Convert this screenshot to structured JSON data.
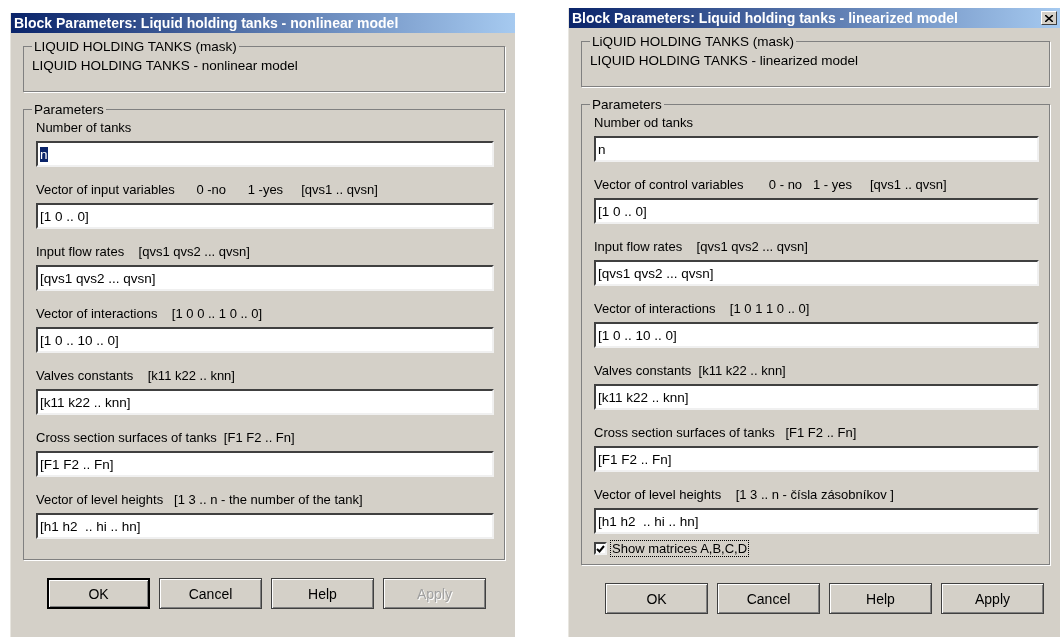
{
  "dialogs": [
    {
      "title": "Block Parameters: Liquid holding tanks - nonlinear model",
      "close_button": false,
      "mask": {
        "title": "LIQUID HOLDING TANKS (mask)",
        "description": "LIQUID HOLDING TANKS - nonlinear model"
      },
      "parameters": {
        "title": "Parameters",
        "fields": [
          {
            "label": "Number of tanks",
            "value": "n",
            "text_selected": true
          },
          {
            "label": "Vector of input variables      0 -no      1 -yes     [qvs1 .. qvsn]",
            "value": "[1 0 .. 0]",
            "text_selected": false
          },
          {
            "label": "Input flow rates    [qvs1 qvs2 ... qvsn]",
            "value": "[qvs1 qvs2 ... qvsn]",
            "text_selected": false
          },
          {
            "label": "Vector of interactions    [1 0 0 .. 1 0 .. 0]",
            "value": "[1 0 .. 10 .. 0]",
            "text_selected": false
          },
          {
            "label": "Valves constants    [k11 k22 .. knn]",
            "value": "[k11 k22 .. knn]",
            "text_selected": false
          },
          {
            "label": "Cross section surfaces of tanks  [F1 F2 .. Fn]",
            "value": "[F1 F2 .. Fn]",
            "text_selected": false
          },
          {
            "label": "Vector of level heights   [1 3 .. n - the number of the tank]",
            "value": "[h1 h2  .. hi .. hn]",
            "text_selected": false
          }
        ]
      },
      "buttons": [
        {
          "label": "OK",
          "default": true,
          "disabled": false
        },
        {
          "label": "Cancel",
          "default": false,
          "disabled": false
        },
        {
          "label": "Help",
          "default": false,
          "disabled": false
        },
        {
          "label": "Apply",
          "default": false,
          "disabled": true
        }
      ]
    },
    {
      "title": "Block Parameters: Liquid holding tanks - linearized model",
      "close_button": true,
      "mask": {
        "title": "LiQUID HOLDING TANKS (mask)",
        "description": "LIQUID HOLDING TANKS - linearized model"
      },
      "parameters": {
        "title": "Parameters",
        "fields": [
          {
            "label": "Number od tanks",
            "value": "n",
            "text_selected": false
          },
          {
            "label": "Vector of control variables       0 - no   1 - yes     [qvs1 .. qvsn]",
            "value": "[1 0 .. 0]",
            "text_selected": false
          },
          {
            "label": "Input flow rates    [qvs1 qvs2 ... qvsn]",
            "value": "[qvs1 qvs2 ... qvsn]",
            "text_selected": false
          },
          {
            "label": "Vector of interactions    [1 0 1 1 0 .. 0]",
            "value": "[1 0 .. 10 .. 0]",
            "text_selected": false
          },
          {
            "label": "Valves constants  [k11 k22 .. knn]",
            "value": "[k11 k22 .. knn]",
            "text_selected": false
          },
          {
            "label": "Cross section surfaces of tanks   [F1 F2 .. Fn]",
            "value": "[F1 F2 .. Fn]",
            "text_selected": false
          },
          {
            "label": "Vector of level heights    [1 3 .. n - čísla zásobníkov ]",
            "value": "[h1 h2  .. hi .. hn]",
            "text_selected": false
          }
        ],
        "checkbox": {
          "label": "Show matrices A,B,C,D",
          "checked": true,
          "focused": true
        }
      },
      "buttons": [
        {
          "label": "OK",
          "default": false,
          "disabled": false
        },
        {
          "label": "Cancel",
          "default": false,
          "disabled": false
        },
        {
          "label": "Help",
          "default": false,
          "disabled": false
        },
        {
          "label": "Apply",
          "default": false,
          "disabled": false
        }
      ]
    }
  ]
}
